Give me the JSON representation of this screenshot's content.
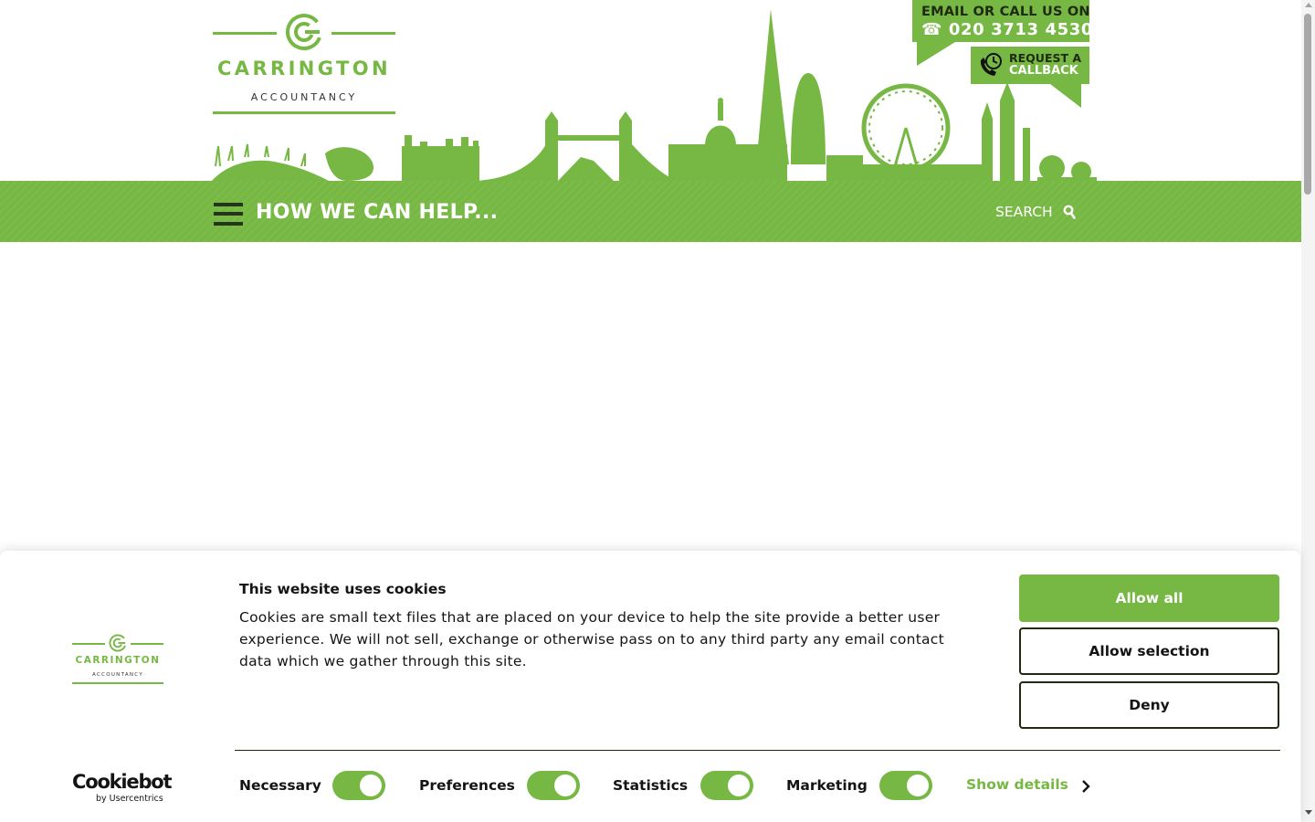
{
  "brand": {
    "name": "CARRINGTON",
    "tagline": "ACCOUNTANCY",
    "accent_color": "#76b843",
    "dark_color": "#1f2a10"
  },
  "header": {
    "contact_label": "EMAIL OR CALL US ON",
    "phone_icon": "telephone-icon",
    "phone_number": "020 3713 4530",
    "callback_line1": "REQUEST A",
    "callback_line2": "CALLBACK",
    "skyline_image": "london-skyline-silhouette"
  },
  "nav": {
    "menu_icon": "hamburger-menu-icon",
    "title": "HOW WE CAN HELP...",
    "search_label": "SEARCH",
    "search_icon": "magnifier-icon"
  },
  "cookie_banner": {
    "title": "This website uses cookies",
    "text": "Cookies are small text files that are placed on your device to help the site provide a better user experience. We will not sell, exchange or otherwise pass on to any third party any email contact data which we gather through this site.",
    "buttons": {
      "allow_all": "Allow all",
      "allow_selection": "Allow selection",
      "deny": "Deny"
    },
    "toggles": [
      {
        "label": "Necessary",
        "on": true
      },
      {
        "label": "Preferences",
        "on": true
      },
      {
        "label": "Statistics",
        "on": true
      },
      {
        "label": "Marketing",
        "on": true
      }
    ],
    "show_details": "Show details",
    "provider": "Cookiebot",
    "provider_sub": "by Usercentrics"
  }
}
